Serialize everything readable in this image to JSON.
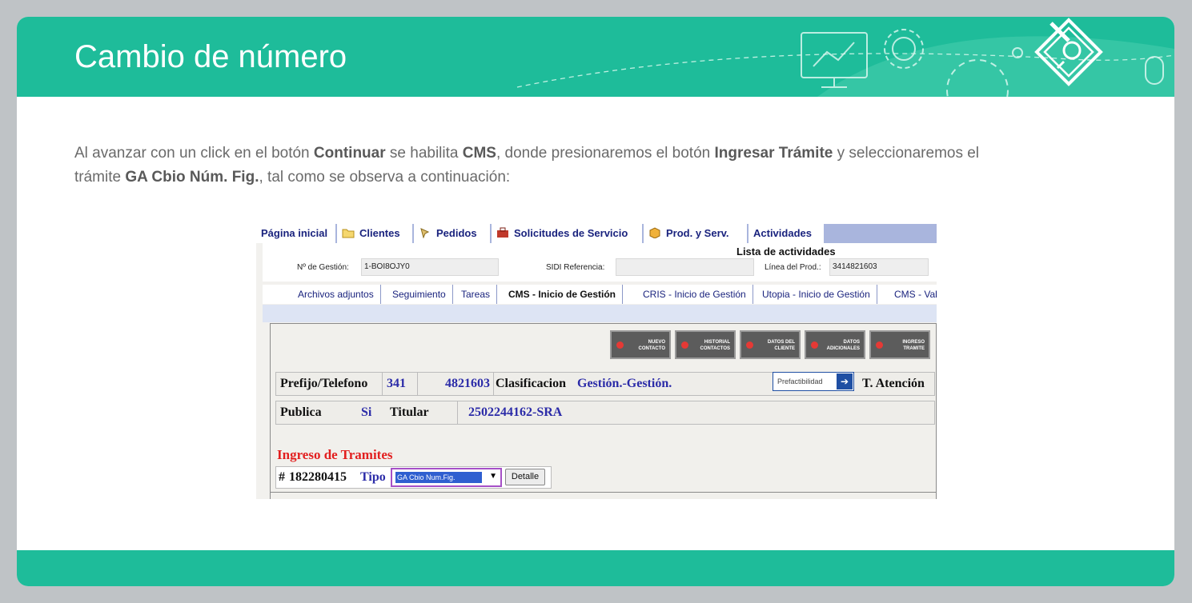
{
  "slide": {
    "title": "Cambio de número",
    "intro": {
      "t1": "Al avanzar con un click en el botón ",
      "b1": "Continuar",
      "t2": " se habilita ",
      "b2": "CMS",
      "t3": ", donde presionaremos el botón ",
      "b3": "Ingresar Trámite",
      "t4": " y seleccionaremos el trámite ",
      "b4": "GA Cbio Núm. Fig.",
      "t5": ", tal como se observa a continuación:"
    }
  },
  "colors": {
    "accent": "#1ebc9a",
    "page_bg": "#bfc3c6",
    "app_blue": "#1a237e",
    "alert_red": "#e21f1f"
  },
  "app": {
    "tabs": [
      {
        "label": "Página inicial",
        "icon": ""
      },
      {
        "label": "Clientes",
        "icon": "folder-icon"
      },
      {
        "label": "Pedidos",
        "icon": "pin-icon"
      },
      {
        "label": "Solicitudes de Servicio",
        "icon": "toolbox-icon"
      },
      {
        "label": "Prod. y Serv.",
        "icon": "box-icon"
      },
      {
        "label": "Actividades",
        "icon": ""
      }
    ],
    "list_title": "Lista de actividades",
    "gestion_label": "Nº de Gestión:",
    "gestion_value": "1-BOI8OJY0",
    "sidi_label": "SIDI Referencia:",
    "sidi_value": "",
    "linea_label": "Línea del Prod.:",
    "linea_value": "3414821603",
    "subtabs": [
      "Archivos adjuntos",
      "Seguimiento",
      "Tareas",
      "CMS - Inicio de Gestión",
      "CRIS - Inicio de Gestión",
      "Utopia - Inicio de Gestión",
      "CMS - Valid"
    ],
    "active_subtab": "CMS - Inicio de Gestión",
    "buttons": [
      {
        "l1": "NUEVO",
        "l2": "CONTACTO"
      },
      {
        "l1": "HISTORIAL",
        "l2": "CONTACTOS"
      },
      {
        "l1": "DATOS DEL",
        "l2": "CLIENTE"
      },
      {
        "l1": "DATOS",
        "l2": "ADICIONALES"
      },
      {
        "l1": "INGRESO",
        "l2": "TRAMITE"
      }
    ],
    "row1": {
      "prefijo_label": "Prefijo/Telefono",
      "prefijo": "341",
      "telefono": "4821603",
      "clasif_label": "Clasificacion",
      "clasif_value": "Gestión.-Gestión.",
      "prefact_label": "Prefactibilidad",
      "atencion_label": "T. Atención"
    },
    "row2": {
      "publica_label": "Publica",
      "publica_value": "Si",
      "titular_label": "Titular",
      "titular_value": "2502244162-SRA"
    },
    "ingreso": {
      "title": "Ingreso de Tramites",
      "hash": "#",
      "number": "182280415",
      "tipo_label": "Tipo",
      "tipo_value": "GA Cbio Num.Fig.",
      "detalle_label": "Detalle"
    }
  }
}
